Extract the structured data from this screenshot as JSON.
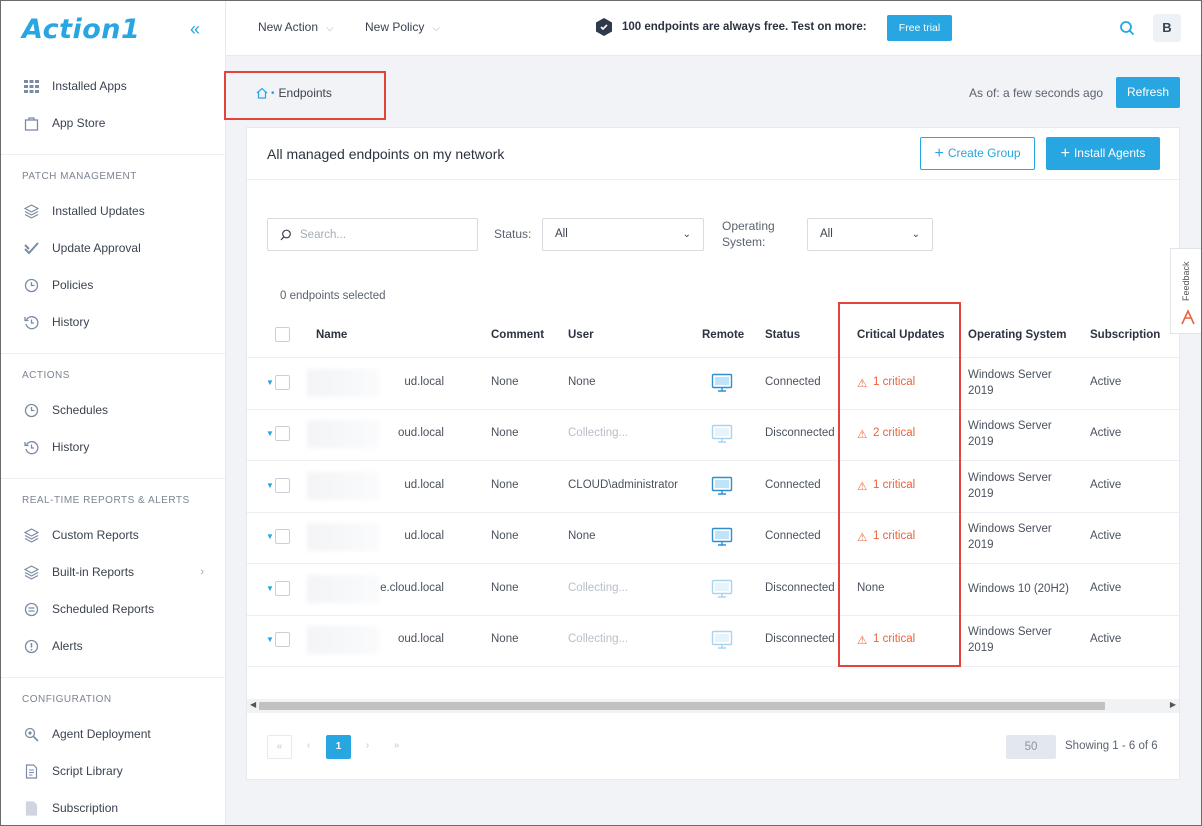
{
  "app": {
    "logo_text": "Action1",
    "accent_color": "#27a6e1",
    "critical_color": "#e8643a"
  },
  "sidebar": {
    "collapse_icon": "double-chevron-left-icon",
    "top_items": [
      {
        "label": "Installed Apps",
        "icon": "grid-icon"
      },
      {
        "label": "App Store",
        "icon": "store-bag-icon"
      }
    ],
    "sections": [
      {
        "title": "PATCH MANAGEMENT",
        "items": [
          {
            "label": "Installed Updates",
            "icon": "layers-icon"
          },
          {
            "label": "Update Approval",
            "icon": "check-badge-icon"
          },
          {
            "label": "Policies",
            "icon": "clock-icon"
          },
          {
            "label": "History",
            "icon": "history-icon"
          }
        ]
      },
      {
        "title": "ACTIONS",
        "items": [
          {
            "label": "Schedules",
            "icon": "clock-icon"
          },
          {
            "label": "History",
            "icon": "history-icon"
          }
        ]
      },
      {
        "title": "REAL-TIME REPORTS & ALERTS",
        "items": [
          {
            "label": "Custom Reports",
            "icon": "layers-icon"
          },
          {
            "label": "Built-in Reports",
            "icon": "layers-icon"
          },
          {
            "label": "Scheduled Reports",
            "icon": "report-clock-icon"
          },
          {
            "label": "Alerts",
            "icon": "alert-circle-icon"
          }
        ]
      },
      {
        "title": "CONFIGURATION",
        "items": [
          {
            "label": "Agent Deployment",
            "icon": "magnifier-gear-icon"
          },
          {
            "label": "Script Library",
            "icon": "document-code-icon"
          },
          {
            "label": "Subscription",
            "icon": "document-icon"
          }
        ]
      }
    ]
  },
  "topbar": {
    "new_action": "New Action",
    "new_policy": "New Policy",
    "promo_text": "100 endpoints are always free. Test on more:",
    "free_trial": "Free trial",
    "avatar_initial": "B"
  },
  "breadcrumb": {
    "current": "Endpoints"
  },
  "status_bar": {
    "as_of": "As of: a few seconds ago",
    "refresh": "Refresh"
  },
  "card": {
    "title": "All managed endpoints on my network",
    "create_group": "Create Group",
    "install_agents": "Install Agents"
  },
  "filters": {
    "search_placeholder": "Search...",
    "status_label": "Status:",
    "status_value": "All",
    "os_label_line1": "Operating",
    "os_label_line2": "System:",
    "os_value": "All",
    "selected_count": "0 endpoints selected"
  },
  "table": {
    "columns": [
      "Name",
      "Comment",
      "User",
      "Remote",
      "Status",
      "Critical Updates",
      "Operating System",
      "Subscription"
    ],
    "rows": [
      {
        "name": "ud.local",
        "comment": "None",
        "user": "None",
        "user_muted": false,
        "remote_active": true,
        "status": "Connected",
        "critical": "1 critical",
        "critical_flag": true,
        "os": "Windows Server 2019",
        "subscription": "Active"
      },
      {
        "name": "oud.local",
        "comment": "None",
        "user": "Collecting...",
        "user_muted": true,
        "remote_active": false,
        "status": "Disconnected",
        "critical": "2 critical",
        "critical_flag": true,
        "os": "Windows Server 2019",
        "subscription": "Active"
      },
      {
        "name": "ud.local",
        "comment": "None",
        "user": "CLOUD\\administrator",
        "user_muted": false,
        "remote_active": true,
        "status": "Connected",
        "critical": "1 critical",
        "critical_flag": true,
        "os": "Windows Server 2019",
        "subscription": "Active"
      },
      {
        "name": "ud.local",
        "comment": "None",
        "user": "None",
        "user_muted": false,
        "remote_active": true,
        "status": "Connected",
        "critical": "1 critical",
        "critical_flag": true,
        "os": "Windows Server 2019",
        "subscription": "Active"
      },
      {
        "name": "e.cloud.local",
        "comment": "None",
        "user": "Collecting...",
        "user_muted": true,
        "remote_active": false,
        "status": "Disconnected",
        "critical": "None",
        "critical_flag": false,
        "os": "Windows 10 (20H2)",
        "subscription": "Active"
      },
      {
        "name": "oud.local",
        "comment": "None",
        "user": "Collecting...",
        "user_muted": true,
        "remote_active": false,
        "status": "Disconnected",
        "critical": "1 critical",
        "critical_flag": true,
        "os": "Windows Server 2019",
        "subscription": "Active"
      }
    ]
  },
  "pagination": {
    "first": "«",
    "prev": "‹",
    "current": "1",
    "next": "›",
    "last": "»",
    "per_page": "50",
    "showing": "Showing 1 - 6 of 6"
  },
  "feedback": {
    "label": "Feedback"
  }
}
